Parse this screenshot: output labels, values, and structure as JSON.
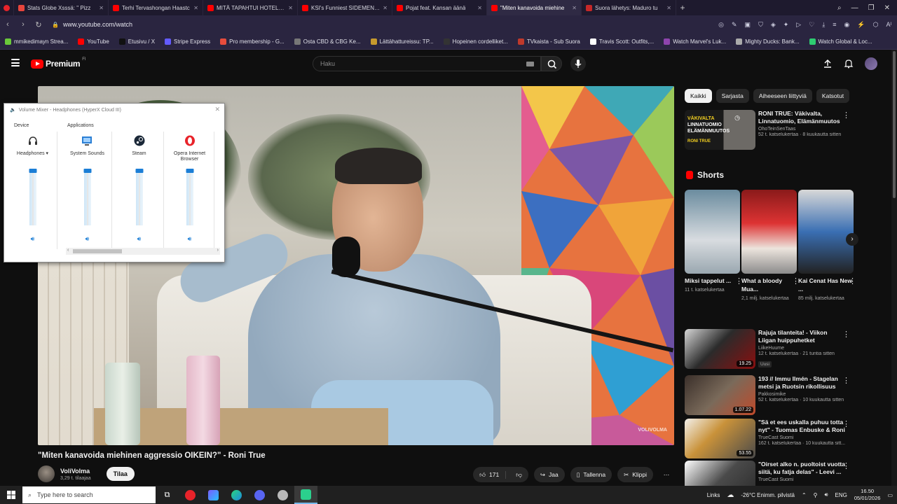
{
  "browser": {
    "tabs": [
      {
        "title": "Stats Globe Xsssä: \" Pizz",
        "color": "#e8453c",
        "active": false
      },
      {
        "title": "Terhi Tervashongan Haastc",
        "color": "#ff0000",
        "active": false
      },
      {
        "title": "MITÄ TAPAHTUI HOTELLIII",
        "color": "#ff0000",
        "active": false
      },
      {
        "title": "KSI's Funniest SIDEMEN M",
        "color": "#ff0000",
        "active": false
      },
      {
        "title": "Pojat feat. Kansan äänä",
        "color": "#ff0000",
        "active": false
      },
      {
        "title": "\"Miten kanavoida miehine",
        "color": "#ff0000",
        "active": true
      },
      {
        "title": "Suora lähetys: Maduro tu",
        "color": "#c62828",
        "active": false
      }
    ],
    "new_tab": "+",
    "url": "www.youtube.com/watch",
    "bookmarks": [
      {
        "label": "mmikedimayn Strea...",
        "color": "#6ac83a"
      },
      {
        "label": "YouTube",
        "color": "#ff0000"
      },
      {
        "label": "Etusivu / X",
        "color": "#111111"
      },
      {
        "label": "Stripe Express",
        "color": "#635bff"
      },
      {
        "label": "Pro membership - G...",
        "color": "#e74c3c"
      },
      {
        "label": "Osta CBD & CBG Ke...",
        "color": "#777777"
      },
      {
        "label": "Lättähattureissu: TP...",
        "color": "#c79a2d"
      },
      {
        "label": "Hopeinen cordelliket...",
        "color": "#333333"
      },
      {
        "label": "TVkaista - Sub Suora",
        "color": "#c0392b"
      },
      {
        "label": "Travis Scott: Outfits,...",
        "color": "#ffffff"
      },
      {
        "label": "Watch Marvel's Luk...",
        "color": "#8e44ad"
      },
      {
        "label": "Mighty Ducks: Bank...",
        "color": "#aaaaaa"
      },
      {
        "label": "Watch Global & Loc...",
        "color": "#2ecc71"
      }
    ]
  },
  "youtube": {
    "logo_text": "Premium",
    "logo_sup": "FI",
    "search_placeholder": "Haku",
    "video_title": "\"Miten kanavoida miehinen aggressio OIKEIN?\" - Roni True",
    "channel_name": "VoliVolma",
    "channel_subs": "3,29 t. tilaajaa",
    "subscribe_label": "Tilaa",
    "like_count": "171",
    "share_label": "Jaa",
    "save_label": "Tallenna",
    "clip_label": "Klippi",
    "watermark": "VOLIVOLMA",
    "chips": [
      {
        "label": "Kaikki",
        "active": true
      },
      {
        "label": "Sarjasta",
        "active": false
      },
      {
        "label": "Aiheeseen liittyviä",
        "active": false
      },
      {
        "label": "Katsotut",
        "active": false
      }
    ],
    "top_rec": {
      "title": "RONI TRUE: Väkivalta, Linnatuomio, Elämänmuutos ja...",
      "channel": "OhoTeinSenTaas",
      "views": "52 t. katselukertaa · 8 kuukautta sitten",
      "thumb_text_1": "VÄKIVALTA",
      "thumb_text_2": "LINNATUOMIO",
      "thumb_text_3": "ELÄMÄNMUUTOS",
      "thumb_text_4": "RONI TRUE"
    },
    "shorts_header": "Shorts",
    "shorts": [
      {
        "title": "Miksi tappelut ...",
        "views": "11 t. katselukertaa"
      },
      {
        "title": "What a bloody Mua...",
        "views": "2,1 milj. katselukertaa"
      },
      {
        "title": "Kai Cenat Has New ...",
        "views": "85 milj. katselukertaa"
      }
    ],
    "recs": [
      {
        "title": "Rajuja tilanteita! - Viikon Liigan huippuhetket",
        "channel": "LiikeHuume",
        "views": "12 t. katselukertaa · 21 tuntia sitten",
        "badge": "Uusi",
        "duration": "19.25"
      },
      {
        "title": "193 // Immu Ilmén - Stagelan metsi ja Ruotsin rikollisuus",
        "channel": "Pakkosimike",
        "views": "52 t. katselukertaa · 10 kuukautta sitten",
        "badge": "",
        "duration": "1.07.22"
      },
      {
        "title": "\"Sä et ees uskalla puhuu totta nyt\" - Tuomas Enbuske & Roni ...",
        "channel": "TrueCast Suomi",
        "views": "162 t. katselukertaa · 10 kuukautta sitt...",
        "badge": "",
        "duration": "53.55"
      },
      {
        "title": "\"Oirset alko n. puoltoist vuotta siitä, ku fatja delas\" - Leevi ...",
        "channel": "TrueCast Suomi",
        "views": "",
        "badge": "",
        "duration": ""
      }
    ]
  },
  "volume_mixer": {
    "title": "Volume Mixer - Headphones (HyperX Cloud III)",
    "device_header": "Device",
    "apps_header": "Applications",
    "columns": [
      {
        "label": "Headphones",
        "level": 1.0,
        "icon": "headphones-icon"
      },
      {
        "label": "System Sounds",
        "level": 1.0,
        "icon": "system-sounds-icon"
      },
      {
        "label": "Steam",
        "level": 1.0,
        "icon": "steam-icon"
      },
      {
        "label": "Opera Internet Browser",
        "level": 1.0,
        "icon": "opera-icon"
      }
    ]
  },
  "taskbar": {
    "search_placeholder": "Type here to search",
    "links_label": "Links",
    "weather": "-26°C  Enimm. pilvistä",
    "language": "ENG",
    "time": "16.50",
    "date": "05/01/2026"
  }
}
